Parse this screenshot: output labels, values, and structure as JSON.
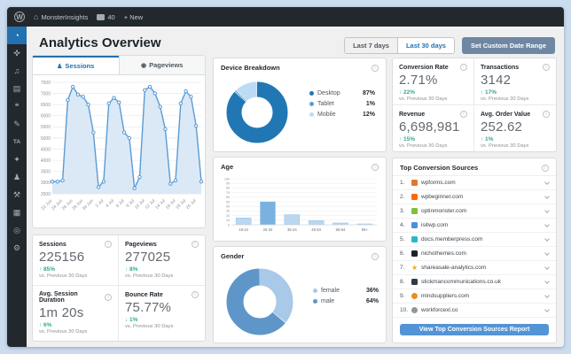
{
  "colors": {
    "positive": "#36a88c",
    "accent_blue": "#2271b1",
    "line": "#5b9bd5",
    "area_fill": "#d9e8f7"
  },
  "admin_bar": {
    "site_name": "MonsterInsights",
    "comments_count": "40",
    "new_label": "+ New",
    "wp_logo": "W"
  },
  "sidebar": {
    "items": [
      {
        "name": "dashboard",
        "glyph": "◔",
        "active": true
      },
      {
        "name": "posts",
        "glyph": "✜",
        "active": false
      },
      {
        "name": "media",
        "glyph": "♫",
        "active": false
      },
      {
        "name": "pages",
        "glyph": "▤",
        "active": false
      },
      {
        "name": "comments",
        "glyph": "❝",
        "active": false
      },
      {
        "name": "appearance",
        "glyph": "✎",
        "active": false
      },
      {
        "name": "analytics-ta",
        "glyph": "TA",
        "active": false,
        "text": true
      },
      {
        "name": "plugins",
        "glyph": "✦",
        "active": false
      },
      {
        "name": "users",
        "glyph": "♟",
        "active": false
      },
      {
        "name": "tools",
        "glyph": "⚒",
        "active": false
      },
      {
        "name": "settings",
        "glyph": "▦",
        "active": false
      },
      {
        "name": "insights",
        "glyph": "◎",
        "active": false
      },
      {
        "name": "collapse",
        "glyph": "⚙",
        "active": false
      }
    ]
  },
  "header": {
    "title": "Analytics Overview"
  },
  "date_controls": {
    "last7": "Last 7 days",
    "last30": "Last 30 days",
    "set_custom": "Set Custom Date Range"
  },
  "chart_tabs": {
    "sessions": "Sessions",
    "pageviews": "Pageviews",
    "sessions_icon": "person-icon",
    "pageviews_icon": "eye-icon"
  },
  "chart_data": [
    {
      "type": "area",
      "name": "sessions_over_time",
      "title": "Sessions",
      "values": [
        3050,
        3050,
        3100,
        6700,
        7300,
        6950,
        6850,
        6500,
        5250,
        2800,
        3050,
        6550,
        6800,
        6600,
        5250,
        5000,
        2750,
        3250,
        7150,
        7300,
        7000,
        6400,
        5400,
        2950,
        3100,
        6550,
        7100,
        6850,
        5550,
        3050
      ],
      "xticks": [
        "22 Jun",
        "24 Jun",
        "26 Jun",
        "28 Jun",
        "30 Jun",
        "2 Jul",
        "4 Jul",
        "6 Jul",
        "8 Jul",
        "10 Jul",
        "12 Jul",
        "14 Jul",
        "16 Jul",
        "18 Jul",
        "20 Jul"
      ],
      "yticks": [
        2500,
        3000,
        3500,
        4000,
        4500,
        5000,
        5500,
        6000,
        6500,
        7000,
        7500
      ],
      "ylim": [
        2500,
        7500
      ],
      "grid": true,
      "legend_position": "none"
    },
    {
      "type": "pie",
      "name": "device_breakdown",
      "title": "Device Breakdown",
      "labels": [
        "Desktop",
        "Tablet",
        "Mobile"
      ],
      "values": [
        87,
        1,
        12
      ],
      "display": [
        "87%",
        "1%",
        "12%"
      ],
      "colors": [
        "#2077b4",
        "#56a0d8",
        "#bcdcf5"
      ],
      "legend_position": "right"
    },
    {
      "type": "bar",
      "name": "age",
      "title": "Age",
      "categories": [
        "18-24",
        "25-34",
        "35-44",
        "45-54",
        "55-64",
        "65+"
      ],
      "values": [
        15,
        50,
        22,
        9,
        4,
        2
      ],
      "bar_colors": [
        "#b9d7ef",
        "#79b2e0",
        "#b9d7ef",
        "#b9d7ef",
        "#b9d7ef",
        "#b9d7ef"
      ],
      "yticks": [
        0,
        10,
        20,
        30,
        40,
        50,
        60,
        70,
        80,
        90,
        100
      ],
      "ylim": [
        0,
        100
      ],
      "grid": true
    },
    {
      "type": "pie",
      "name": "gender",
      "title": "Gender",
      "labels": [
        "female",
        "male"
      ],
      "values": [
        36,
        64
      ],
      "display": [
        "36%",
        "64%"
      ],
      "colors": [
        "#a9c9e8",
        "#5e96c9"
      ],
      "legend_position": "right"
    }
  ],
  "stats": {
    "left": [
      {
        "label": "Sessions",
        "value": "225156",
        "dir": "up",
        "change": "85%",
        "note": "vs. Previous 30 Days"
      },
      {
        "label": "Pageviews",
        "value": "277025",
        "dir": "up",
        "change": "8%",
        "note": "vs. Previous 30 Days"
      },
      {
        "label": "Avg. Session Duration",
        "value": "1m 20s",
        "dir": "up",
        "change": "6%",
        "note": "vs. Previous 30 Days"
      },
      {
        "label": "Bounce Rate",
        "value": "75.77%",
        "dir": "down",
        "change": "1%",
        "note": "vs. Previous 30 Days"
      }
    ],
    "right": [
      {
        "label": "Conversion Rate",
        "value": "2.71%",
        "dir": "up",
        "change": "22%",
        "note": "vs. Previous 30 Days"
      },
      {
        "label": "Transactions",
        "value": "3142",
        "dir": "up",
        "change": "17%",
        "note": "vs. Previous 30 Days"
      },
      {
        "label": "Revenue",
        "value": "6,698,981",
        "dir": "up",
        "change": "15%",
        "note": "vs. Previous 30 Days"
      },
      {
        "label": "Avg. Order Value",
        "value": "252.62",
        "dir": "up",
        "change": "1%",
        "note": "vs. Previous 30 Days"
      }
    ]
  },
  "sources": {
    "title": "Top Conversion Sources",
    "button": "View Top Conversion Sources Report",
    "items": [
      {
        "rank": "1.",
        "domain": "wpforms.com",
        "icon_color": "#e27730",
        "icon_shape": "square"
      },
      {
        "rank": "2.",
        "domain": "wpbeginner.com",
        "icon_color": "#ff6900",
        "icon_shape": "square"
      },
      {
        "rank": "3.",
        "domain": "optinmonster.com",
        "icon_color": "#7fbf3f",
        "icon_shape": "square"
      },
      {
        "rank": "4.",
        "domain": "isitwp.com",
        "icon_color": "#4a90d9",
        "icon_shape": "square"
      },
      {
        "rank": "5.",
        "domain": "docs.memberpress.com",
        "icon_color": "#29b6c9",
        "icon_shape": "square"
      },
      {
        "rank": "6.",
        "domain": "nichothemes.com",
        "icon_color": "#1d2327",
        "icon_shape": "square"
      },
      {
        "rank": "7.",
        "domain": "shareasale-analytics.com",
        "icon_color": "#f7a51c",
        "icon_shape": "star"
      },
      {
        "rank": "8.",
        "domain": "stickmancommunications.co.uk",
        "icon_color": "#2c3a4d",
        "icon_shape": "square"
      },
      {
        "rank": "9.",
        "domain": "mindsuppliers.com",
        "icon_color": "#f08a24",
        "icon_shape": "circle"
      },
      {
        "rank": "10.",
        "domain": "workforcexl.co",
        "icon_color": "#8f979e",
        "icon_shape": "circle"
      }
    ]
  }
}
